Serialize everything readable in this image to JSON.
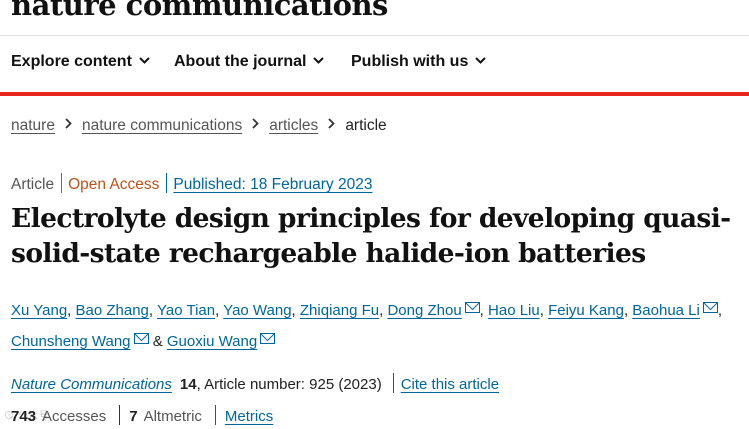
{
  "header": {
    "logo_text": "nature communications"
  },
  "nav": {
    "items": [
      {
        "label": "Explore content"
      },
      {
        "label": "About the journal"
      },
      {
        "label": "Publish with us"
      }
    ]
  },
  "breadcrumb": {
    "items": [
      "nature",
      "nature communications",
      "articles"
    ],
    "current": "article"
  },
  "article_meta": {
    "type": "Article",
    "access": "Open Access",
    "published": "Published: 18 February 2023"
  },
  "article": {
    "title": "Electrolyte design principles for developing quasi-solid-state rechargeable halide-ion batteries"
  },
  "authors": [
    "Xu Yang",
    "Bao Zhang",
    "Yao Tian",
    "Yao Wang",
    "Zhiqiang Fu",
    "Dong Zhou",
    "Hao Liu",
    "Feiyu Kang",
    "Baohua Li",
    "Chunsheng Wang",
    "Guoxiu Wang"
  ],
  "authors_conjunction": "&",
  "citation": {
    "journal": "Nature Communications",
    "volume": "14",
    "article_number": ", Article number: 925 (2023)",
    "cite_label": "Cite this article"
  },
  "metrics": {
    "accesses_count": "743",
    "accesses_label": "Accesses",
    "altmetric_count": "7",
    "altmetric_label": "Altmetric",
    "metrics_link": "Metrics"
  },
  "colors": {
    "accent_red": "#e6261f",
    "link_blue": "#006699",
    "open_access_orange": "#b9531c"
  },
  "icons": [
    "chevron-down-icon",
    "chevron-right-icon",
    "envelope-icon"
  ]
}
